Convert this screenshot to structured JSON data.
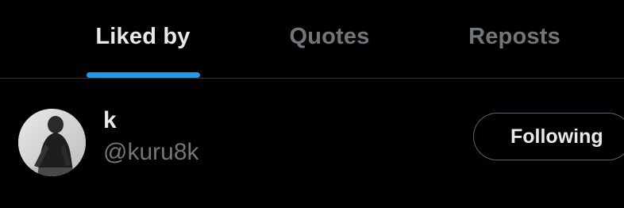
{
  "tabs": [
    {
      "label": "Liked by",
      "active": true
    },
    {
      "label": "Quotes",
      "active": false
    },
    {
      "label": "Reposts",
      "active": false
    }
  ],
  "users": [
    {
      "display_name": "k",
      "handle": "@kuru8k",
      "follow_button": "Following",
      "avatar_icon": "user-avatar-photo"
    }
  ],
  "colors": {
    "background": "#000000",
    "accent": "#1d9bf0",
    "text_primary": "#e7e9ea",
    "text_secondary": "#71767b",
    "divider": "#2f3336"
  }
}
